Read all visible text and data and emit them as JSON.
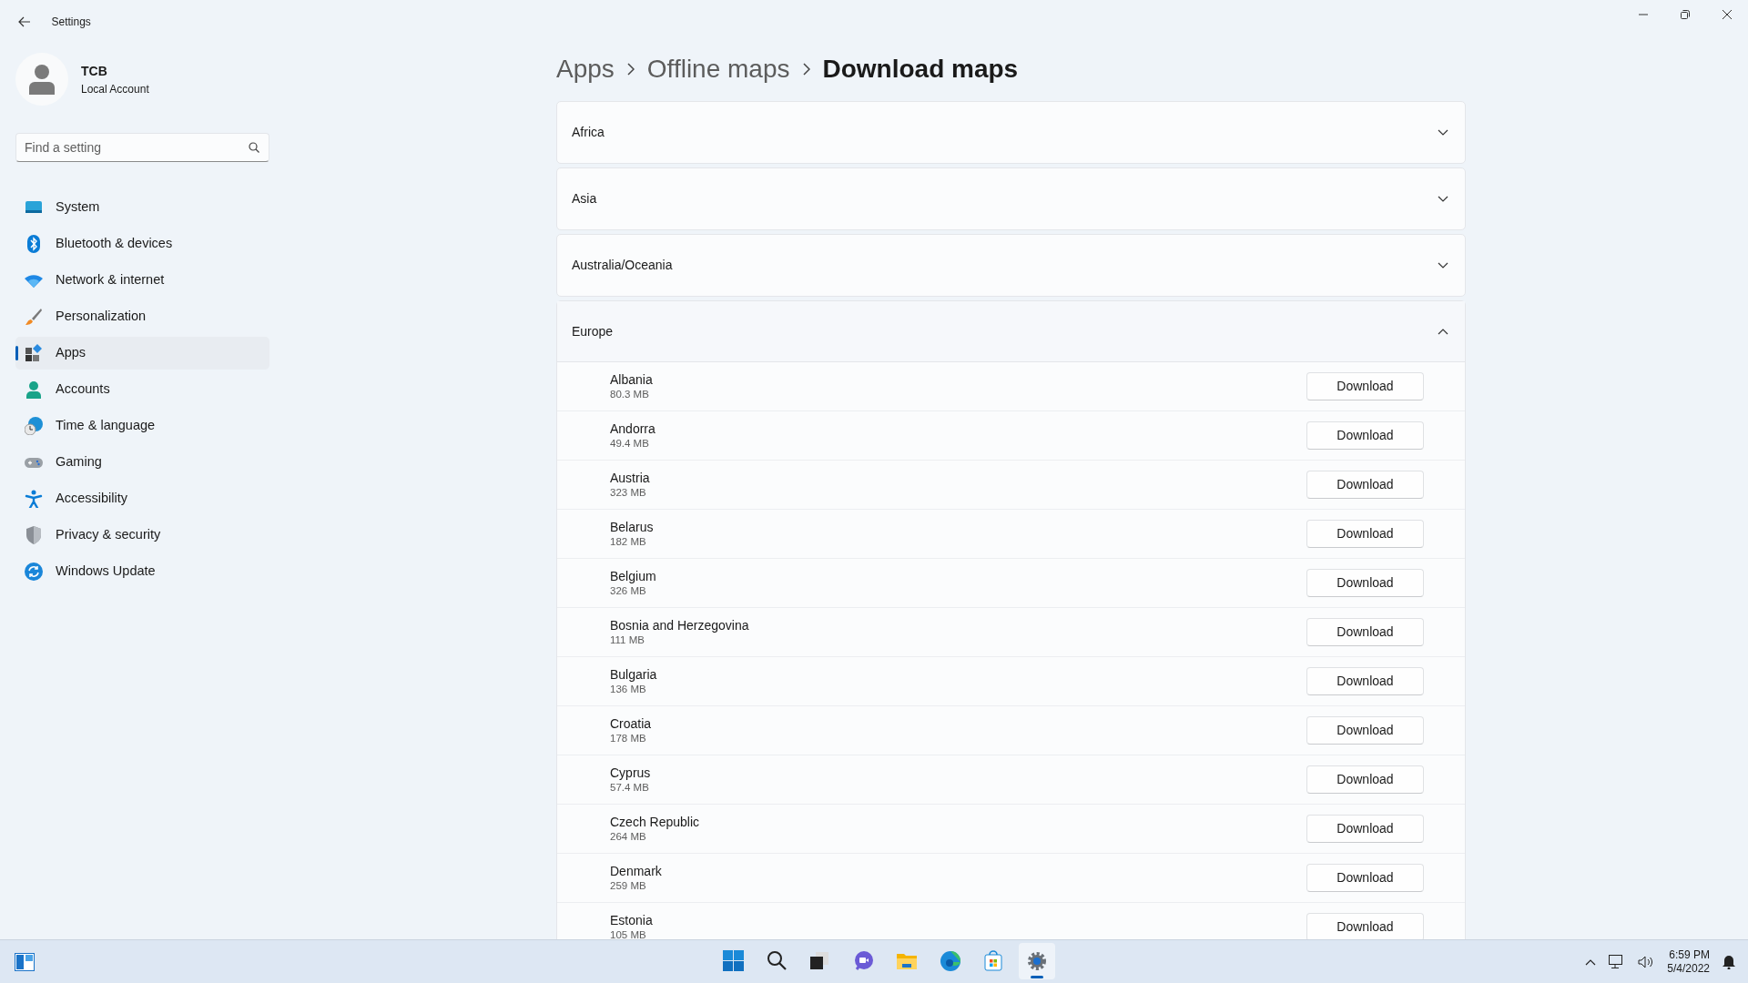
{
  "window": {
    "title": "Settings"
  },
  "account": {
    "name": "TCB",
    "type": "Local Account"
  },
  "search": {
    "placeholder": "Find a setting"
  },
  "sidebar": {
    "items": [
      {
        "label": "System",
        "selected": false
      },
      {
        "label": "Bluetooth & devices",
        "selected": false
      },
      {
        "label": "Network & internet",
        "selected": false
      },
      {
        "label": "Personalization",
        "selected": false
      },
      {
        "label": "Apps",
        "selected": true
      },
      {
        "label": "Accounts",
        "selected": false
      },
      {
        "label": "Time & language",
        "selected": false
      },
      {
        "label": "Gaming",
        "selected": false
      },
      {
        "label": "Accessibility",
        "selected": false
      },
      {
        "label": "Privacy & security",
        "selected": false
      },
      {
        "label": "Windows Update",
        "selected": false
      }
    ]
  },
  "breadcrumb": [
    "Apps",
    "Offline maps",
    "Download maps"
  ],
  "regions": [
    {
      "name": "Africa",
      "expanded": false
    },
    {
      "name": "Asia",
      "expanded": false
    },
    {
      "name": "Australia/Oceania",
      "expanded": false
    },
    {
      "name": "Europe",
      "expanded": true,
      "maps": [
        {
          "name": "Albania",
          "size": "80.3 MB",
          "action": "Download"
        },
        {
          "name": "Andorra",
          "size": "49.4 MB",
          "action": "Download"
        },
        {
          "name": "Austria",
          "size": "323 MB",
          "action": "Download"
        },
        {
          "name": "Belarus",
          "size": "182 MB",
          "action": "Download"
        },
        {
          "name": "Belgium",
          "size": "326 MB",
          "action": "Download"
        },
        {
          "name": "Bosnia and Herzegovina",
          "size": "111 MB",
          "action": "Download"
        },
        {
          "name": "Bulgaria",
          "size": "136 MB",
          "action": "Download"
        },
        {
          "name": "Croatia",
          "size": "178 MB",
          "action": "Download"
        },
        {
          "name": "Cyprus",
          "size": "57.4 MB",
          "action": "Download"
        },
        {
          "name": "Czech Republic",
          "size": "264 MB",
          "action": "Download"
        },
        {
          "name": "Denmark",
          "size": "259 MB",
          "action": "Download"
        },
        {
          "name": "Estonia",
          "size": "105 MB",
          "action": "Download"
        }
      ]
    }
  ],
  "taskbar": {
    "apps": [
      {
        "selected": false
      },
      {
        "selected": false
      },
      {
        "selected": false
      },
      {
        "selected": false
      },
      {
        "selected": false
      },
      {
        "selected": false
      },
      {
        "selected": false
      },
      {
        "selected": true
      }
    ],
    "time": "6:59 PM",
    "date": "5/4/2022"
  }
}
